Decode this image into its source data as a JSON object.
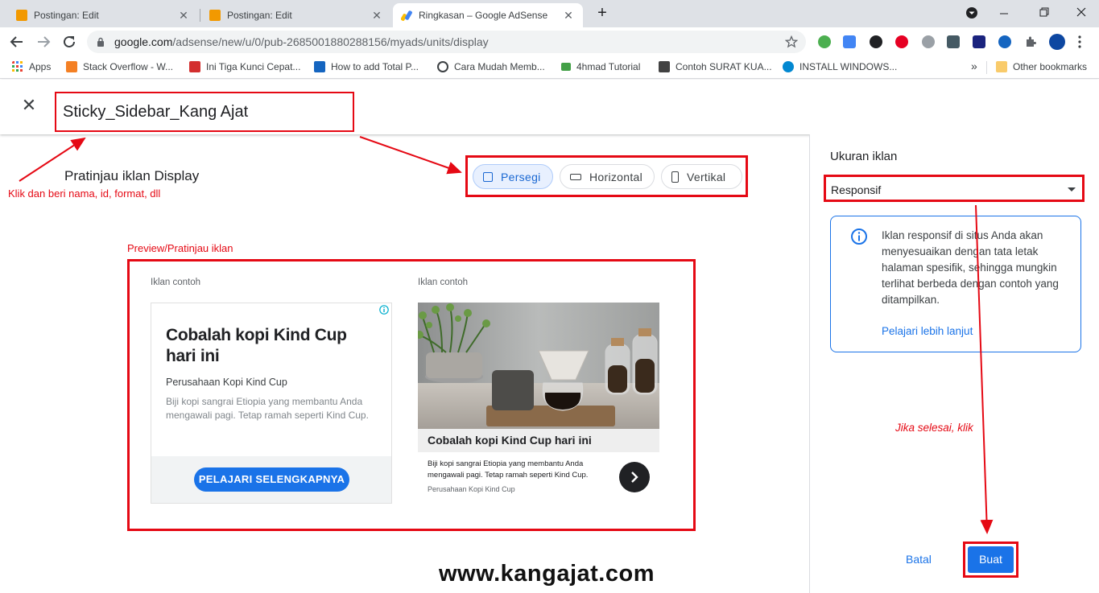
{
  "browser": {
    "tabs": [
      {
        "title": "Postingan: Edit",
        "close": "✕",
        "favicon_color": "#f29900"
      },
      {
        "title": "Postingan: Edit",
        "close": "✕",
        "favicon_color": "#f29900"
      },
      {
        "title": "Ringkasan – Google AdSense",
        "close": "✕",
        "favicon_color": "#4285f4"
      }
    ],
    "new_tab": "+",
    "url_host": "google.com",
    "url_path": "/adsense/new/u/0/pub-2685001880288156/myads/units/display",
    "bookmarks": [
      {
        "label": "Apps"
      },
      {
        "label": "Stack Overflow - W..."
      },
      {
        "label": "Ini Tiga Kunci Cepat..."
      },
      {
        "label": "How to add Total P..."
      },
      {
        "label": "Cara Mudah Memb..."
      },
      {
        "label": "4hmad Tutorial"
      },
      {
        "label": "Contoh SURAT KUA..."
      },
      {
        "label": "INSTALL WINDOWS..."
      }
    ],
    "bookmarks_more": "»",
    "other_bookmarks": "Other bookmarks"
  },
  "editor": {
    "close": "✕",
    "ad_unit_name": "Sticky_Sidebar_Kang Ajat",
    "preview_title": "Pratinjau iklan Display",
    "formats": [
      {
        "label": "Persegi",
        "selected": true
      },
      {
        "label": "Horizontal",
        "selected": false
      },
      {
        "label": "Vertikal",
        "selected": false
      }
    ]
  },
  "annotations": {
    "name_hint": "Klik dan beri nama, id, format, dll",
    "preview_hint": "Preview/Pratinjau iklan",
    "done_hint": "Jika selesai, klik",
    "color": "#e50914"
  },
  "preview": {
    "sample_label_1": "Iklan contoh",
    "sample_label_2": "Iklan contoh",
    "ad1": {
      "headline": "Cobalah kopi Kind Cup hari ini",
      "advertiser": "Perusahaan Kopi Kind Cup",
      "description": "Biji kopi sangrai Etiopia yang membantu Anda mengawali pagi. Tetap ramah seperti Kind Cup.",
      "cta": "PELAJARI SELENGKAPNYA"
    },
    "ad2": {
      "headline": "Cobalah kopi Kind Cup hari ini",
      "description": "Biji kopi sangrai Etiopia yang membantu Anda mengawali pagi. Tetap ramah seperti Kind Cup.",
      "advertiser": "Perusahaan Kopi Kind Cup"
    }
  },
  "sidebar": {
    "size_label": "Ukuran iklan",
    "size_value": "Responsif",
    "info_text": "Iklan responsif di situs Anda akan menyesuaikan dengan tata letak halaman spesifik, sehingga mungkin terlihat berbeda dengan contoh yang ditampilkan.",
    "info_link": "Pelajari lebih lanjut",
    "cancel": "Batal",
    "create": "Buat"
  },
  "watermark": "www.kangajat.com",
  "colors": {
    "accent": "#1a73e8",
    "annotation": "#e50914"
  }
}
